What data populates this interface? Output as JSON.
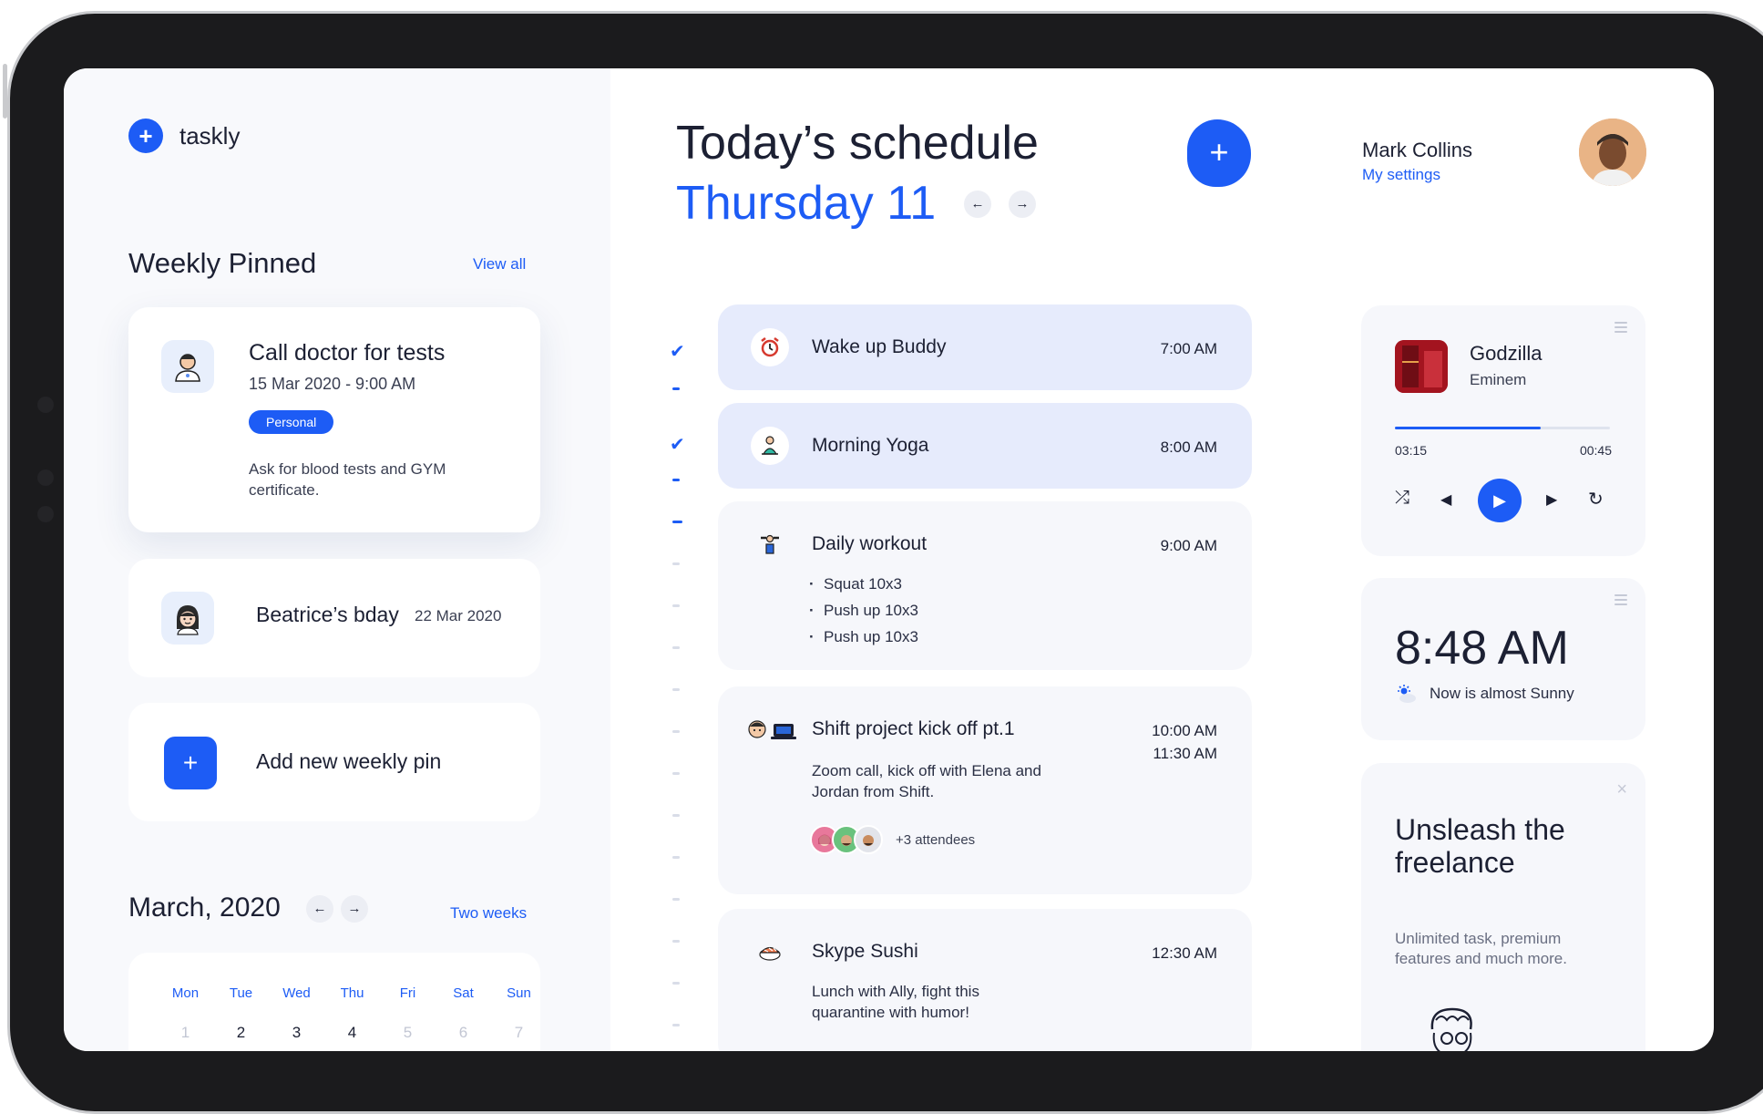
{
  "app": {
    "name": "taskly"
  },
  "pinned": {
    "title": "Weekly Pinned",
    "view_all": "View all",
    "main_pin": {
      "title": "Call doctor for tests",
      "datetime": "15 Mar 2020 - 9:00 AM",
      "tag": "Personal",
      "description": "Ask for blood tests and GYM certificate."
    },
    "secondary_pin": {
      "title": "Beatrice’s bday",
      "date": "22 Mar 2020"
    },
    "add_label": "Add new weekly pin",
    "add_symbol": "+"
  },
  "calendar": {
    "month": "March, 2020",
    "mode_link": "Two weeks",
    "prev": "←",
    "next": "→",
    "days": [
      "Mon",
      "Tue",
      "Wed",
      "Thu",
      "Fri",
      "Sat",
      "Sun"
    ],
    "dates": [
      "1",
      "2",
      "3",
      "4",
      "5",
      "6",
      "7"
    ]
  },
  "schedule": {
    "title": "Today’s schedule",
    "day": "Thursday 11",
    "prev": "←",
    "next": "→",
    "add_symbol": "+",
    "check": "✔",
    "tasks": [
      {
        "title": "Wake up Buddy",
        "time": "7:00 AM",
        "done": true,
        "icon": "alarm-clock-icon"
      },
      {
        "title": "Morning Yoga",
        "time": "8:00 AM",
        "done": true,
        "icon": "yoga-icon"
      },
      {
        "title": "Daily workout",
        "time": "9:00 AM",
        "done": false,
        "icon": "dumbbell-icon",
        "items": [
          "Squat 10x3",
          "Push up 10x3",
          "Push up 10x3"
        ]
      },
      {
        "title": "Shift project kick off pt.1",
        "time_start": "10:00 AM",
        "time_end": "11:30 AM",
        "done": false,
        "icon": "laptop-icon",
        "description": "Zoom call, kick off with Elena and Jordan from Shift.",
        "attendees_label": "+3 attendees"
      },
      {
        "title": "Skype Sushi",
        "time": "12:30 AM",
        "done": false,
        "icon": "sushi-icon",
        "description": "Lunch with Ally, fight this quarantine with humor!"
      }
    ]
  },
  "user": {
    "name": "Mark Collins",
    "settings_link": "My settings"
  },
  "player": {
    "song": "Godzilla",
    "artist": "Eminem",
    "elapsed": "03:15",
    "total": "00:45",
    "progress": 0.68,
    "controls": {
      "shuffle": "⤮",
      "prev": "◀",
      "play": "▶",
      "next": "▶",
      "repeat": "↻"
    }
  },
  "clock_widget": {
    "time": "8:48 AM",
    "weather": "Now is almost Sunny"
  },
  "promo": {
    "title": "Unsleash the freelance",
    "text": "Unlimited task, premium features and much more.",
    "close": "×"
  },
  "colors": {
    "accent": "#1d5cf5",
    "done_bg": "#e6ebfc",
    "card_bg": "#f6f7fb"
  }
}
